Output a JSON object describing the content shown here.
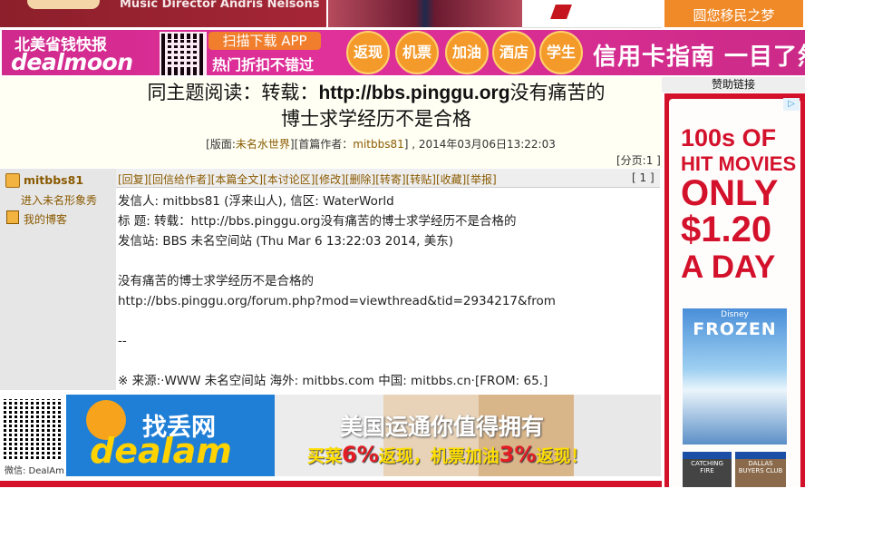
{
  "banners": {
    "top_left_text": "Music Director Andris Nelsons",
    "immigration_text": "圆您移民之梦"
  },
  "dealmoon_ad": {
    "logo_zh": "北美省钱快报",
    "logo_en": "dealmoon",
    "scan_label": "扫描下载 APP",
    "hot_deals": "热门折扣不错过",
    "categories": [
      "返现",
      "机票",
      "加油",
      "酒店",
      "学生"
    ],
    "guide": "信用卡指南 一目了然"
  },
  "thread": {
    "title_prefix": "同主题阅读：转载：",
    "title_url": "http://bbs.pinggu.org",
    "title_suffix": "没有痛苦的",
    "title_line2": "博士求学经历不是合格",
    "meta_board_label": "[版面:",
    "meta_board": "未名水世界",
    "meta_author_label": "][首篇作者：",
    "meta_author": "mitbbs81",
    "meta_date": "] , 2014年03月06日13:22:03",
    "pager": "[分页:1 ]"
  },
  "sponsor": {
    "label": "赞助链接",
    "line1": "100s OF",
    "line2": "HIT MOVIES",
    "line3": "ONLY",
    "line4": "$1.20",
    "line5": "A DAY",
    "movie_brand": "Disney",
    "movie_title": "FROZEN",
    "bluray1": "CATCHING FIRE",
    "bluray2": "DALLAS BUYERS CLUB"
  },
  "user": {
    "name": "mitbbs81",
    "myname_link": "进入未名形象秀",
    "blog_link": "我的博客"
  },
  "post": {
    "actions": [
      "[回复]",
      "[回信给作者]",
      "[本篇全文]",
      "[本讨论区]",
      "[修改]",
      "[删除]",
      "[转寄]",
      "[转贴]",
      "[收藏]",
      "[举报]"
    ],
    "floor": "[ 1 ]",
    "lines": [
      "发信人: mitbbs81 (浮来山人), 信区: WaterWorld",
      "标  题: 转载：http://bbs.pinggu.org没有痛苦的博士求学经历不是合格的",
      "发信站: BBS 未名空间站 (Thu Mar  6 13:22:03 2014, 美东)",
      "",
      "没有痛苦的博士求学经历不是合格的",
      "http://bbs.pinggu.org/forum.php?mod=viewthread&tid=2934217&from",
      "",
      "--",
      "",
      "※ 来源:·WWW 未名空间站 海外: mitbbs.com 中国: mitbbs.cn·[FROM: 65.]"
    ]
  },
  "bottom_ad": {
    "wechat_label": "微信: DealAm",
    "logo_zh": "找丢网",
    "logo_en": "dealam",
    "headline": "美国运通你值得拥有",
    "sub_a": "买菜",
    "sub_pct1": "6%",
    "sub_b": "返现，机票加油",
    "sub_pct2": "3%",
    "sub_c": "返现！"
  }
}
